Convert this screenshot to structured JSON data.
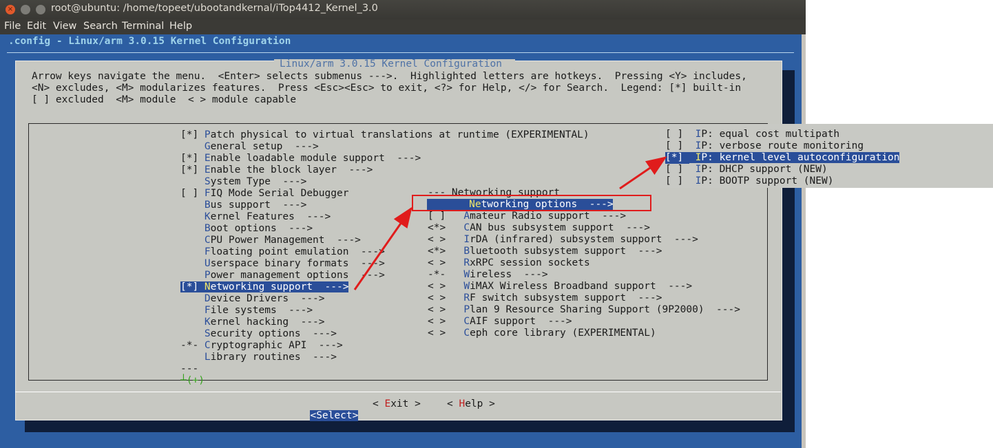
{
  "window": {
    "title": "root@ubuntu: /home/topeet/ubootandkernal/iTop4412_Kernel_3.0",
    "buttons": {
      "close": "×",
      "minimize": "",
      "maximize": ""
    },
    "menu": [
      "File",
      "Edit",
      "View",
      "Search",
      "Terminal",
      "Help"
    ]
  },
  "terminal": {
    "top_title": ".config - Linux/arm 3.0.15 Kernel Configuration",
    "dialog_title": "Linux/arm 3.0.15 Kernel Configuration",
    "help_lines": [
      "Arrow keys navigate the menu.  <Enter> selects submenus --->.  Highlighted letters are hotkeys.  Pressing <Y> includes,",
      "<N> excludes, <M> modularizes features.  Press <Esc><Esc> to exit, <?> for Help, </> for Search.  Legend: [*] built-in",
      "[ ] excluded  <M> module  < > module capable"
    ],
    "main_menu": [
      {
        "prefix": "[*] ",
        "hotkey": "P",
        "rest": "atch physical to virtual translations at runtime (EXPERIMENTAL)"
      },
      {
        "prefix": "    ",
        "hotkey": "G",
        "rest": "eneral setup  --->"
      },
      {
        "prefix": "[*] ",
        "hotkey": "E",
        "rest": "nable loadable module support  --->"
      },
      {
        "prefix": "[*] ",
        "hotkey": "E",
        "rest": "nable the block layer  --->"
      },
      {
        "prefix": "    ",
        "hotkey": "S",
        "rest": "ystem Type  --->"
      },
      {
        "prefix": "[ ] ",
        "hotkey": "F",
        "rest": "IQ Mode Serial Debugger"
      },
      {
        "prefix": "    ",
        "hotkey": "B",
        "rest": "us support  --->"
      },
      {
        "prefix": "    ",
        "hotkey": "K",
        "rest": "ernel Features  --->"
      },
      {
        "prefix": "    ",
        "hotkey": "B",
        "rest": "oot options  --->"
      },
      {
        "prefix": "    ",
        "hotkey": "C",
        "rest": "PU Power Management  --->"
      },
      {
        "prefix": "    ",
        "hotkey": "F",
        "rest": "loating point emulation  --->"
      },
      {
        "prefix": "    ",
        "hotkey": "U",
        "rest": "serspace binary formats  --->"
      },
      {
        "prefix": "    ",
        "hotkey": "P",
        "rest": "ower management options  --->"
      },
      {
        "prefix": "[*] ",
        "hotkey": "N",
        "rest": "etworking support  --->",
        "selected": true
      },
      {
        "prefix": "    ",
        "hotkey": "D",
        "rest": "evice Drivers  --->"
      },
      {
        "prefix": "    ",
        "hotkey": "F",
        "rest": "ile systems  --->"
      },
      {
        "prefix": "    ",
        "hotkey": "K",
        "rest": "ernel hacking  --->"
      },
      {
        "prefix": "    ",
        "hotkey": "S",
        "rest": "ecurity options  --->"
      },
      {
        "prefix": "-*- ",
        "hotkey": "C",
        "rest": "ryptographic API  --->"
      },
      {
        "prefix": "    ",
        "hotkey": "L",
        "rest": "ibrary routines  --->"
      },
      {
        "prefix": "--- ",
        "hotkey": "",
        "rest": ""
      }
    ],
    "scroll_indicator": "┴(+)",
    "networking_menu": {
      "header": "--- Networking support",
      "items": [
        {
          "prefix": "",
          "hotkey": "Ne",
          "rest": "tworking options  --->",
          "selected": true
        },
        {
          "prefix": "[ ]",
          "hotkey": "A",
          "rest": "mateur Radio support  --->"
        },
        {
          "prefix": "<*>",
          "hotkey": "C",
          "rest": "AN bus subsystem support  --->"
        },
        {
          "prefix": "< >",
          "hotkey": "I",
          "rest": "rDA (infrared) subsystem support  --->"
        },
        {
          "prefix": "<*>",
          "hotkey": "B",
          "rest": "luetooth subsystem support  --->"
        },
        {
          "prefix": "< >",
          "hotkey": "R",
          "rest": "xRPC session sockets"
        },
        {
          "prefix": "-*-",
          "hotkey": "W",
          "rest": "ireless  --->"
        },
        {
          "prefix": "< >",
          "hotkey": "W",
          "rest": "iMAX Wireless Broadband support  --->"
        },
        {
          "prefix": "< >",
          "hotkey": "R",
          "rest": "F switch subsystem support  --->"
        },
        {
          "prefix": "< >",
          "hotkey": "P",
          "rest": "lan 9 Resource Sharing Support (9P2000)  --->"
        },
        {
          "prefix": "< >",
          "hotkey": "C",
          "rest": "AIF support  --->"
        },
        {
          "prefix": "< >",
          "hotkey": "C",
          "rest": "eph core library (EXPERIMENTAL)"
        }
      ]
    },
    "ip_popup": [
      {
        "prefix": "[ ]",
        "hotkey": "I",
        "rest": "P: equal cost multipath"
      },
      {
        "prefix": "[ ]",
        "hotkey": "I",
        "rest": "P: verbose route monitoring"
      },
      {
        "prefix": "[*]",
        "hotkey": "I",
        "rest": "P: kernel level autoconfiguration",
        "selected": true
      },
      {
        "prefix": "[ ]",
        "hotkey": "I",
        "rest": "P: DHCP support (NEW)"
      },
      {
        "prefix": "[ ]",
        "hotkey": "I",
        "rest": "P: BOOTP support (NEW)"
      }
    ],
    "buttons": {
      "select": "<Select>",
      "exit_open": "< ",
      "exit_hotkey": "E",
      "exit_rest": "xit >",
      "help_open": "< ",
      "help_hotkey": "H",
      "help_rest": "elp >"
    }
  },
  "annotation_color": "#e01c1c"
}
